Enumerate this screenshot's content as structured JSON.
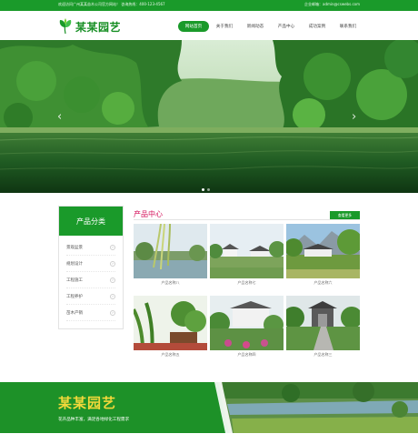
{
  "topbar": {
    "welcome": "欢迎访问广州某某苗木公司官方网站！  咨询热线：400-123-4567",
    "email": "企业邮箱：admin@cswebs.com"
  },
  "header": {
    "brand": "某某园艺",
    "nav": [
      "网站首页",
      "关于我们",
      "新闻动态",
      "产品中心",
      "成功案例",
      "联系我们"
    ],
    "active_nav": "网站首页"
  },
  "banner": {
    "prev_icon": "‹",
    "next_icon": "›",
    "slide_count": 2,
    "active_slide": 1
  },
  "sidebar": {
    "title": "产品分类",
    "items": [
      "景观盆景",
      "规划设计",
      "工程施工",
      "工程养护",
      "苗木产销"
    ]
  },
  "products": {
    "title": "产品中心",
    "more": "查看更多",
    "items": [
      {
        "name": "产品名称八"
      },
      {
        "name": "产品名称七"
      },
      {
        "name": "产品名称六"
      },
      {
        "name": "产品名称五"
      },
      {
        "name": "产品名称四"
      },
      {
        "name": "产品名称三"
      }
    ]
  },
  "footer": {
    "slogan": "某某园艺",
    "subslogan": "花卉品种丰富，满足各地绿化工程需求"
  },
  "colors": {
    "brand_green": "#1a9a2a",
    "title_pink": "#d5155d",
    "slogan_yellow": "#f2d83a"
  },
  "icons": {
    "logo": "leaf-logo-icon",
    "sidebar_chevron": "chevron-right-icon"
  }
}
